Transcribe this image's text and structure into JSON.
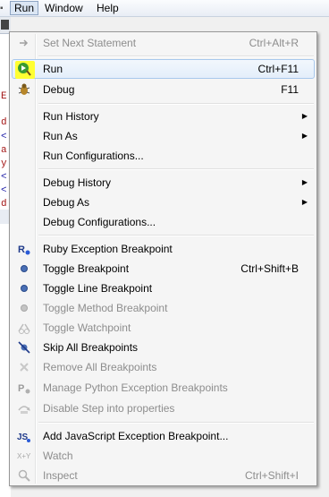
{
  "menubar": {
    "items": [
      {
        "label": "Run"
      },
      {
        "label": "Window"
      },
      {
        "label": "Help"
      }
    ]
  },
  "editor": {
    "lines": [
      "E",
      "d",
      "<",
      "a",
      "y",
      "<",
      "<",
      "d"
    ]
  },
  "menu": {
    "set_next_statement": {
      "label": "Set Next Statement",
      "accel": "Ctrl+Alt+R"
    },
    "run": {
      "label": "Run",
      "accel": "Ctrl+F11"
    },
    "debug": {
      "label": "Debug",
      "accel": "F11"
    },
    "run_history": {
      "label": "Run History"
    },
    "run_as": {
      "label": "Run As"
    },
    "run_configurations": {
      "label": "Run Configurations..."
    },
    "debug_history": {
      "label": "Debug History"
    },
    "debug_as": {
      "label": "Debug As"
    },
    "debug_configurations": {
      "label": "Debug Configurations..."
    },
    "ruby_exception_breakpoint": {
      "label": "Ruby Exception Breakpoint"
    },
    "toggle_breakpoint": {
      "label": "Toggle Breakpoint",
      "accel": "Ctrl+Shift+B"
    },
    "toggle_line_breakpoint": {
      "label": "Toggle Line Breakpoint"
    },
    "toggle_method_breakpoint": {
      "label": "Toggle Method Breakpoint"
    },
    "toggle_watchpoint": {
      "label": "Toggle Watchpoint"
    },
    "skip_all_breakpoints": {
      "label": "Skip All Breakpoints"
    },
    "remove_all_breakpoints": {
      "label": "Remove All Breakpoints"
    },
    "manage_python_exception_breakpoints": {
      "label": "Manage Python Exception Breakpoints"
    },
    "disable_step_into_properties": {
      "label": "Disable Step into properties"
    },
    "add_js_exception_breakpoint": {
      "label": "Add JavaScript Exception Breakpoint..."
    },
    "watch": {
      "label": "Watch"
    },
    "inspect": {
      "label": "Inspect",
      "accel": "Ctrl+Shift+I"
    }
  },
  "icons": {
    "ruby_badge": "R",
    "python_badge": "P",
    "js_badge": "JS",
    "watch_badge": "X+Y"
  },
  "colors": {
    "highlight": "#ffff33",
    "selection_border": "#a8c8ec",
    "disabled_text": "#8d8d8d"
  }
}
